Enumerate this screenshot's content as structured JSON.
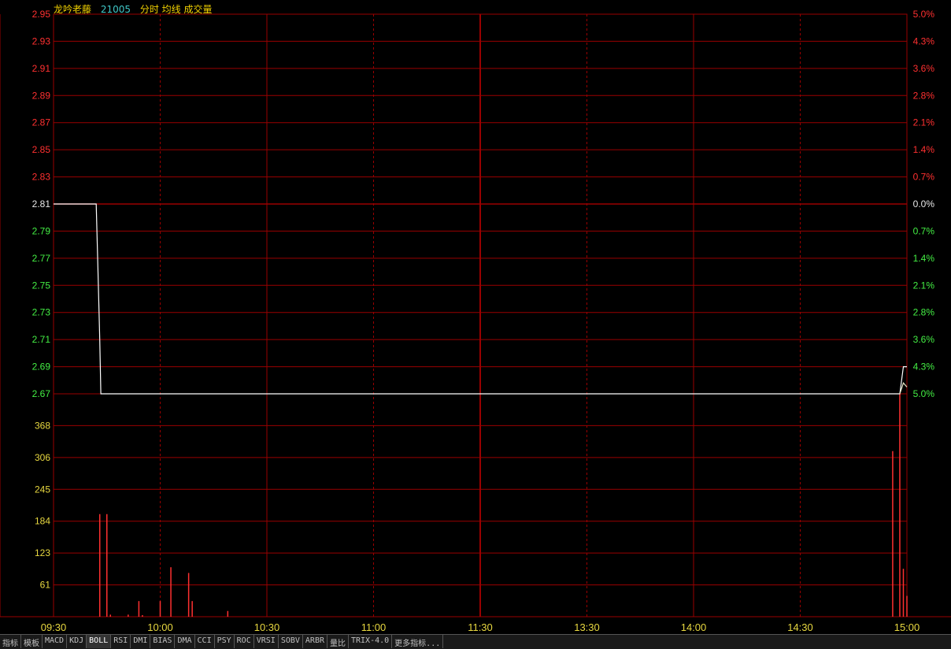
{
  "header": {
    "name": "龙吟老藤",
    "code": "21005",
    "items": "分时 均线 成交量"
  },
  "colors": {
    "up": "#ff3030",
    "down": "#44ee44",
    "neutral": "#e8e8e8",
    "grid": "#9a0000",
    "vol_axis": "#e8d840",
    "price_line": "#ffffff",
    "avg_line": "#e8e8c8",
    "name": "#f0d000",
    "code": "#40c8c8",
    "volume_bar": "#ff3030"
  },
  "tabs": [
    "指标",
    "模板",
    "MACD",
    "KDJ",
    "BOLL",
    "RSI",
    "DMI",
    "BIAS",
    "DMA",
    "CCI",
    "PSY",
    "ROC",
    "VRSI",
    "SOBV",
    "ARBR",
    "量比",
    "TRIX-4.0",
    "更多指标..."
  ],
  "chart_data": {
    "type": "line",
    "prev_close": 2.81,
    "price_ticks": [
      "2.95",
      "2.93",
      "2.91",
      "2.89",
      "2.87",
      "2.85",
      "2.83",
      "2.81",
      "2.79",
      "2.77",
      "2.75",
      "2.73",
      "2.71",
      "2.69",
      "2.67"
    ],
    "pct_ticks": [
      "5.0%",
      "4.3%",
      "3.6%",
      "2.8%",
      "2.1%",
      "1.4%",
      "0.7%",
      "0.0%",
      "0.7%",
      "1.4%",
      "2.1%",
      "2.8%",
      "3.6%",
      "4.3%",
      "5.0%"
    ],
    "ylim": [
      2.67,
      2.95
    ],
    "time_ticks": [
      "09:30",
      "10:00",
      "10:30",
      "11:00",
      "11:30",
      "13:30",
      "14:00",
      "14:30",
      "15:00"
    ],
    "minutes_total": 240,
    "price_series": [
      {
        "minute": 0,
        "price": 2.81
      },
      {
        "minute": 12,
        "price": 2.81
      },
      {
        "minute": 12.5,
        "price": 2.76
      },
      {
        "minute": 13,
        "price": 2.71
      },
      {
        "minute": 13.3,
        "price": 2.67
      },
      {
        "minute": 238,
        "price": 2.67
      },
      {
        "minute": 239,
        "price": 2.69
      },
      {
        "minute": 240,
        "price": 2.69
      }
    ],
    "avg_series": [
      {
        "minute": 238,
        "price": 2.67
      },
      {
        "minute": 239,
        "price": 2.678
      },
      {
        "minute": 240,
        "price": 2.675
      }
    ],
    "volume_ticks": [
      "368",
      "306",
      "245",
      "184",
      "123",
      "61"
    ],
    "volume_max": 428,
    "volume": [
      {
        "minute": 13,
        "value": 197
      },
      {
        "minute": 15,
        "value": 197
      },
      {
        "minute": 16,
        "value": 4
      },
      {
        "minute": 21,
        "value": 4
      },
      {
        "minute": 24,
        "value": 30
      },
      {
        "minute": 25,
        "value": 3
      },
      {
        "minute": 30,
        "value": 30
      },
      {
        "minute": 33,
        "value": 95
      },
      {
        "minute": 38,
        "value": 84
      },
      {
        "minute": 39,
        "value": 30
      },
      {
        "minute": 49,
        "value": 11
      },
      {
        "minute": 236,
        "value": 318
      },
      {
        "minute": 238,
        "value": 428
      },
      {
        "minute": 239,
        "value": 92
      },
      {
        "minute": 240,
        "value": 40
      }
    ]
  }
}
